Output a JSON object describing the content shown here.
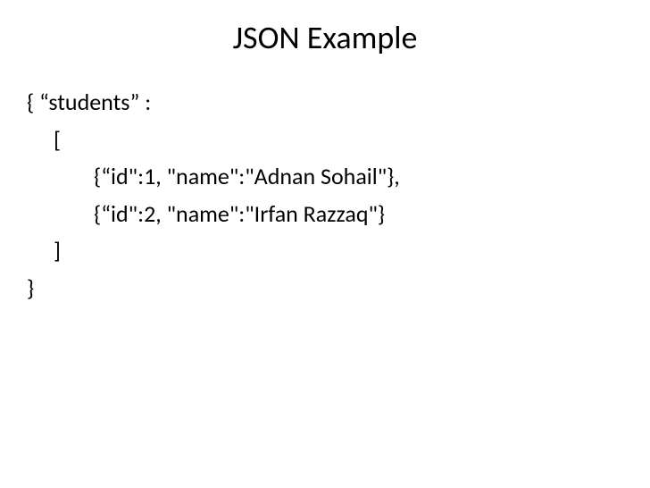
{
  "title": "JSON Example",
  "code": {
    "line1": "{ “students” :",
    "line2": "[",
    "line3": "{“id\":1, \"name\":\"Adnan Sohail\"},",
    "line4": "{“id\":2, \"name\":\"Irfan Razzaq\"}",
    "line5": "]",
    "line6": "}"
  }
}
